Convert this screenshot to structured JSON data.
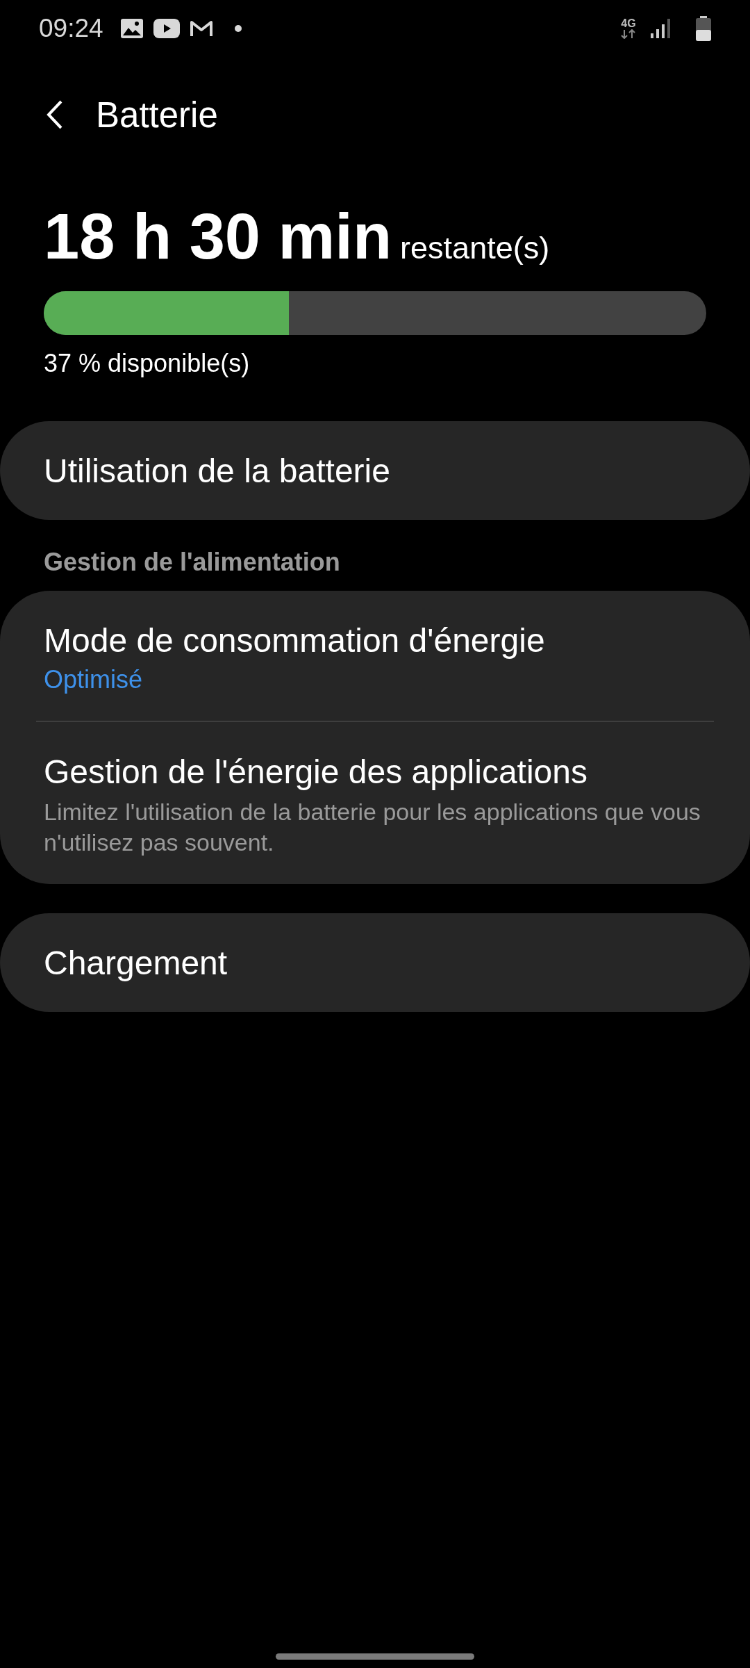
{
  "status_bar": {
    "time": "09:24",
    "network": "4G"
  },
  "header": {
    "title": "Batterie"
  },
  "summary": {
    "time_left": "18 h 30 min",
    "time_suffix": "restante(s)",
    "level": 0.37,
    "available": "37 % disponible(s)"
  },
  "usage_card": {
    "label": "Utilisation de la batterie"
  },
  "section": {
    "title": "Gestion de l'alimentation"
  },
  "power_card": {
    "items": [
      {
        "title": "Mode de consommation d'énergie",
        "value": "Optimisé"
      },
      {
        "title": "Gestion de l'énergie des applications",
        "description": "Limitez l'utilisation de la batterie pour les applications que vous n'utilisez pas souvent."
      }
    ]
  },
  "charging_card": {
    "label": "Chargement"
  }
}
